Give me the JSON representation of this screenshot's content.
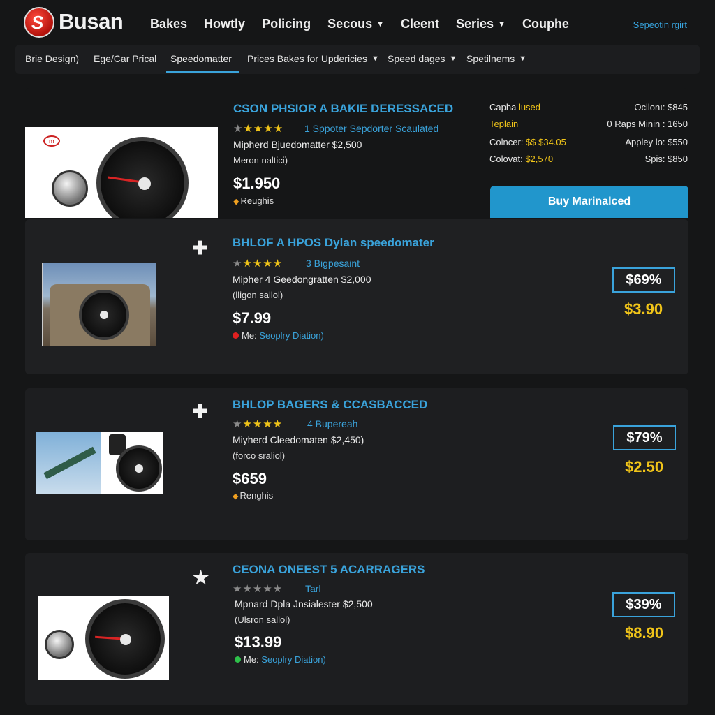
{
  "header": {
    "brand": "Busan",
    "logo_letter": "S",
    "nav": [
      "Bakes",
      "Howtly",
      "Policing",
      "Secous",
      "Cleent",
      "Series",
      "Couphe"
    ],
    "nav_dropdowns": [
      false,
      false,
      false,
      true,
      false,
      true,
      false
    ],
    "top_link": "Sepeotin rgirt"
  },
  "subnav": {
    "items": [
      "Brie Design)",
      "Ege/Car Prical",
      "Speedomatter",
      "Prices Bakes for Updericies",
      "Speed dages",
      "Spetilnems"
    ],
    "dropdowns": [
      false,
      false,
      false,
      true,
      true,
      true
    ],
    "active": "Speedomatter"
  },
  "featured": {
    "title": "CSON PHSIOR A BAKIE DERESSACED",
    "stars": "★★★★★",
    "reviews": "1 Sppoter Sepdorter Scaulated",
    "desc": "Mipherd Bjuedomatter $2,500",
    "sub": "Meron naltici)",
    "price": "$1.950",
    "meta": "Reughis",
    "specs": {
      "left": [
        {
          "label": "Capha",
          "value": "lused"
        },
        {
          "label": "Teplain",
          "value": ""
        },
        {
          "label": "Colncer:",
          "value": "$$ $34.05"
        },
        {
          "label": "Colovat:",
          "value": "$2,570"
        }
      ],
      "right": [
        "Ocllonı: $845",
        "0 Raps Minin : 1650",
        "Appley lo: $550",
        "Spis: $850"
      ]
    },
    "buy_label": "Buy Marinalced"
  },
  "listings": [
    {
      "title": "BHLOF A HPOS Dylan speedomater",
      "stars": "★★★★★",
      "reviews": "3 Bigpesaint",
      "desc": "Mipher 4 Geedongratten $2,000",
      "sub": "(lligon sallol)",
      "price": "$7.99",
      "meta_prefix": "Me:",
      "meta_link": "Seoplry Diation)",
      "box_price": "$69%",
      "gold_price": "$3.90",
      "dot_color": "#e02020"
    },
    {
      "title": "BHLOP BAGERS & CCASBACCED",
      "stars": "★★★★★",
      "reviews": "4 Bupereah",
      "desc": "Miyherd Cleedomaten $2,450)",
      "sub": "(forco sraliol)",
      "price": "$659",
      "meta_prefix": "Renghis",
      "meta_link": "",
      "box_price": "$79%",
      "gold_price": "$2.50"
    },
    {
      "title": "CEONA ONEEST 5 ACARRAGERS",
      "stars": "★★★★★",
      "reviews": "Tarl",
      "desc": "Mpnard Dpla Jnsialester $2,500",
      "sub": "(Ulsron sallol)",
      "price": "$13.99",
      "meta_prefix": "Me:",
      "meta_link": "Seoplry Diation)",
      "box_price": "$39%",
      "gold_price": "$8.90",
      "dot_color": "#2ec04a"
    }
  ],
  "icons": {
    "plus": "✚",
    "star": "★",
    "caret": "▾",
    "flame": "🔥"
  },
  "colors": {
    "accent": "#3aa3db",
    "gold": "#f0c419",
    "button": "#2196cc",
    "background": "#151617"
  }
}
